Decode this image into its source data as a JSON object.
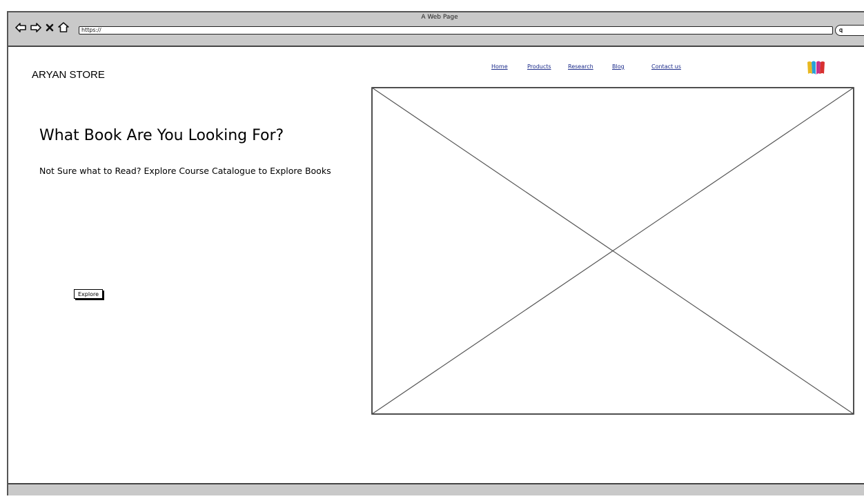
{
  "browser": {
    "window_title": "A Web Page",
    "url": "https://",
    "icons": [
      "back-arrow-icon",
      "forward-arrow-icon",
      "close-x-icon",
      "home-icon",
      "search-icon"
    ]
  },
  "header": {
    "brand": "ARYAN STORE",
    "nav": [
      {
        "label": "Home"
      },
      {
        "label": "Products"
      },
      {
        "label": "Research"
      },
      {
        "label": "Blog"
      },
      {
        "label": "Contact us"
      }
    ],
    "logo_icon": "books-icon"
  },
  "hero": {
    "headline": "What Book Are You Looking For?",
    "subline": "Not Sure what to Read? Explore Course Catalogue to Explore Books",
    "button_label": "Explore",
    "image_placeholder_icon": "image-placeholder-icon"
  },
  "colors": {
    "chrome": "#c9c9c9",
    "link": "#1a2a8a",
    "logo": [
      "#e8b820",
      "#2aa0d8",
      "#c8308a",
      "#d83030"
    ]
  }
}
